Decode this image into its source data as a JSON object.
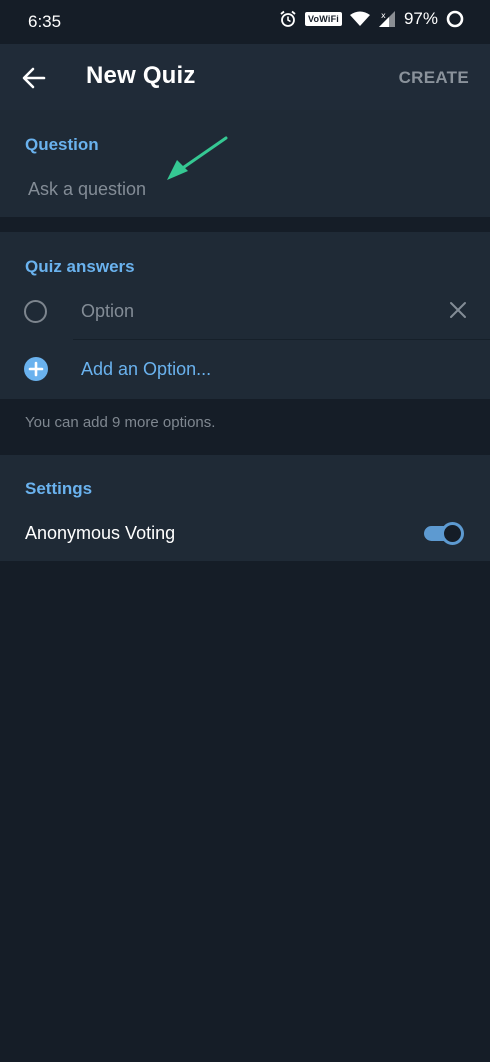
{
  "status_bar": {
    "time": "6:35",
    "vowifi": "VoWiFi",
    "battery": "97%",
    "icons": [
      "alarm-icon",
      "vowifi-icon",
      "wifi-icon",
      "signal-icon",
      "battery-icon"
    ]
  },
  "app_bar": {
    "title": "New Quiz",
    "action": "CREATE",
    "back_icon": "arrow-back-icon"
  },
  "question": {
    "header": "Question",
    "placeholder": "Ask a question"
  },
  "answers": {
    "header": "Quiz answers",
    "options": [
      {
        "placeholder": "Option"
      }
    ],
    "add_option": "Add an Option...",
    "hint": "You can add 9 more options."
  },
  "settings": {
    "header": "Settings",
    "anonymous_voting": {
      "label": "Anonymous Voting",
      "enabled": true
    }
  },
  "colors": {
    "background": "#151d27",
    "surface": "#1f2a36",
    "accent": "#6ab2ee",
    "annotation_arrow": "#35c893"
  }
}
